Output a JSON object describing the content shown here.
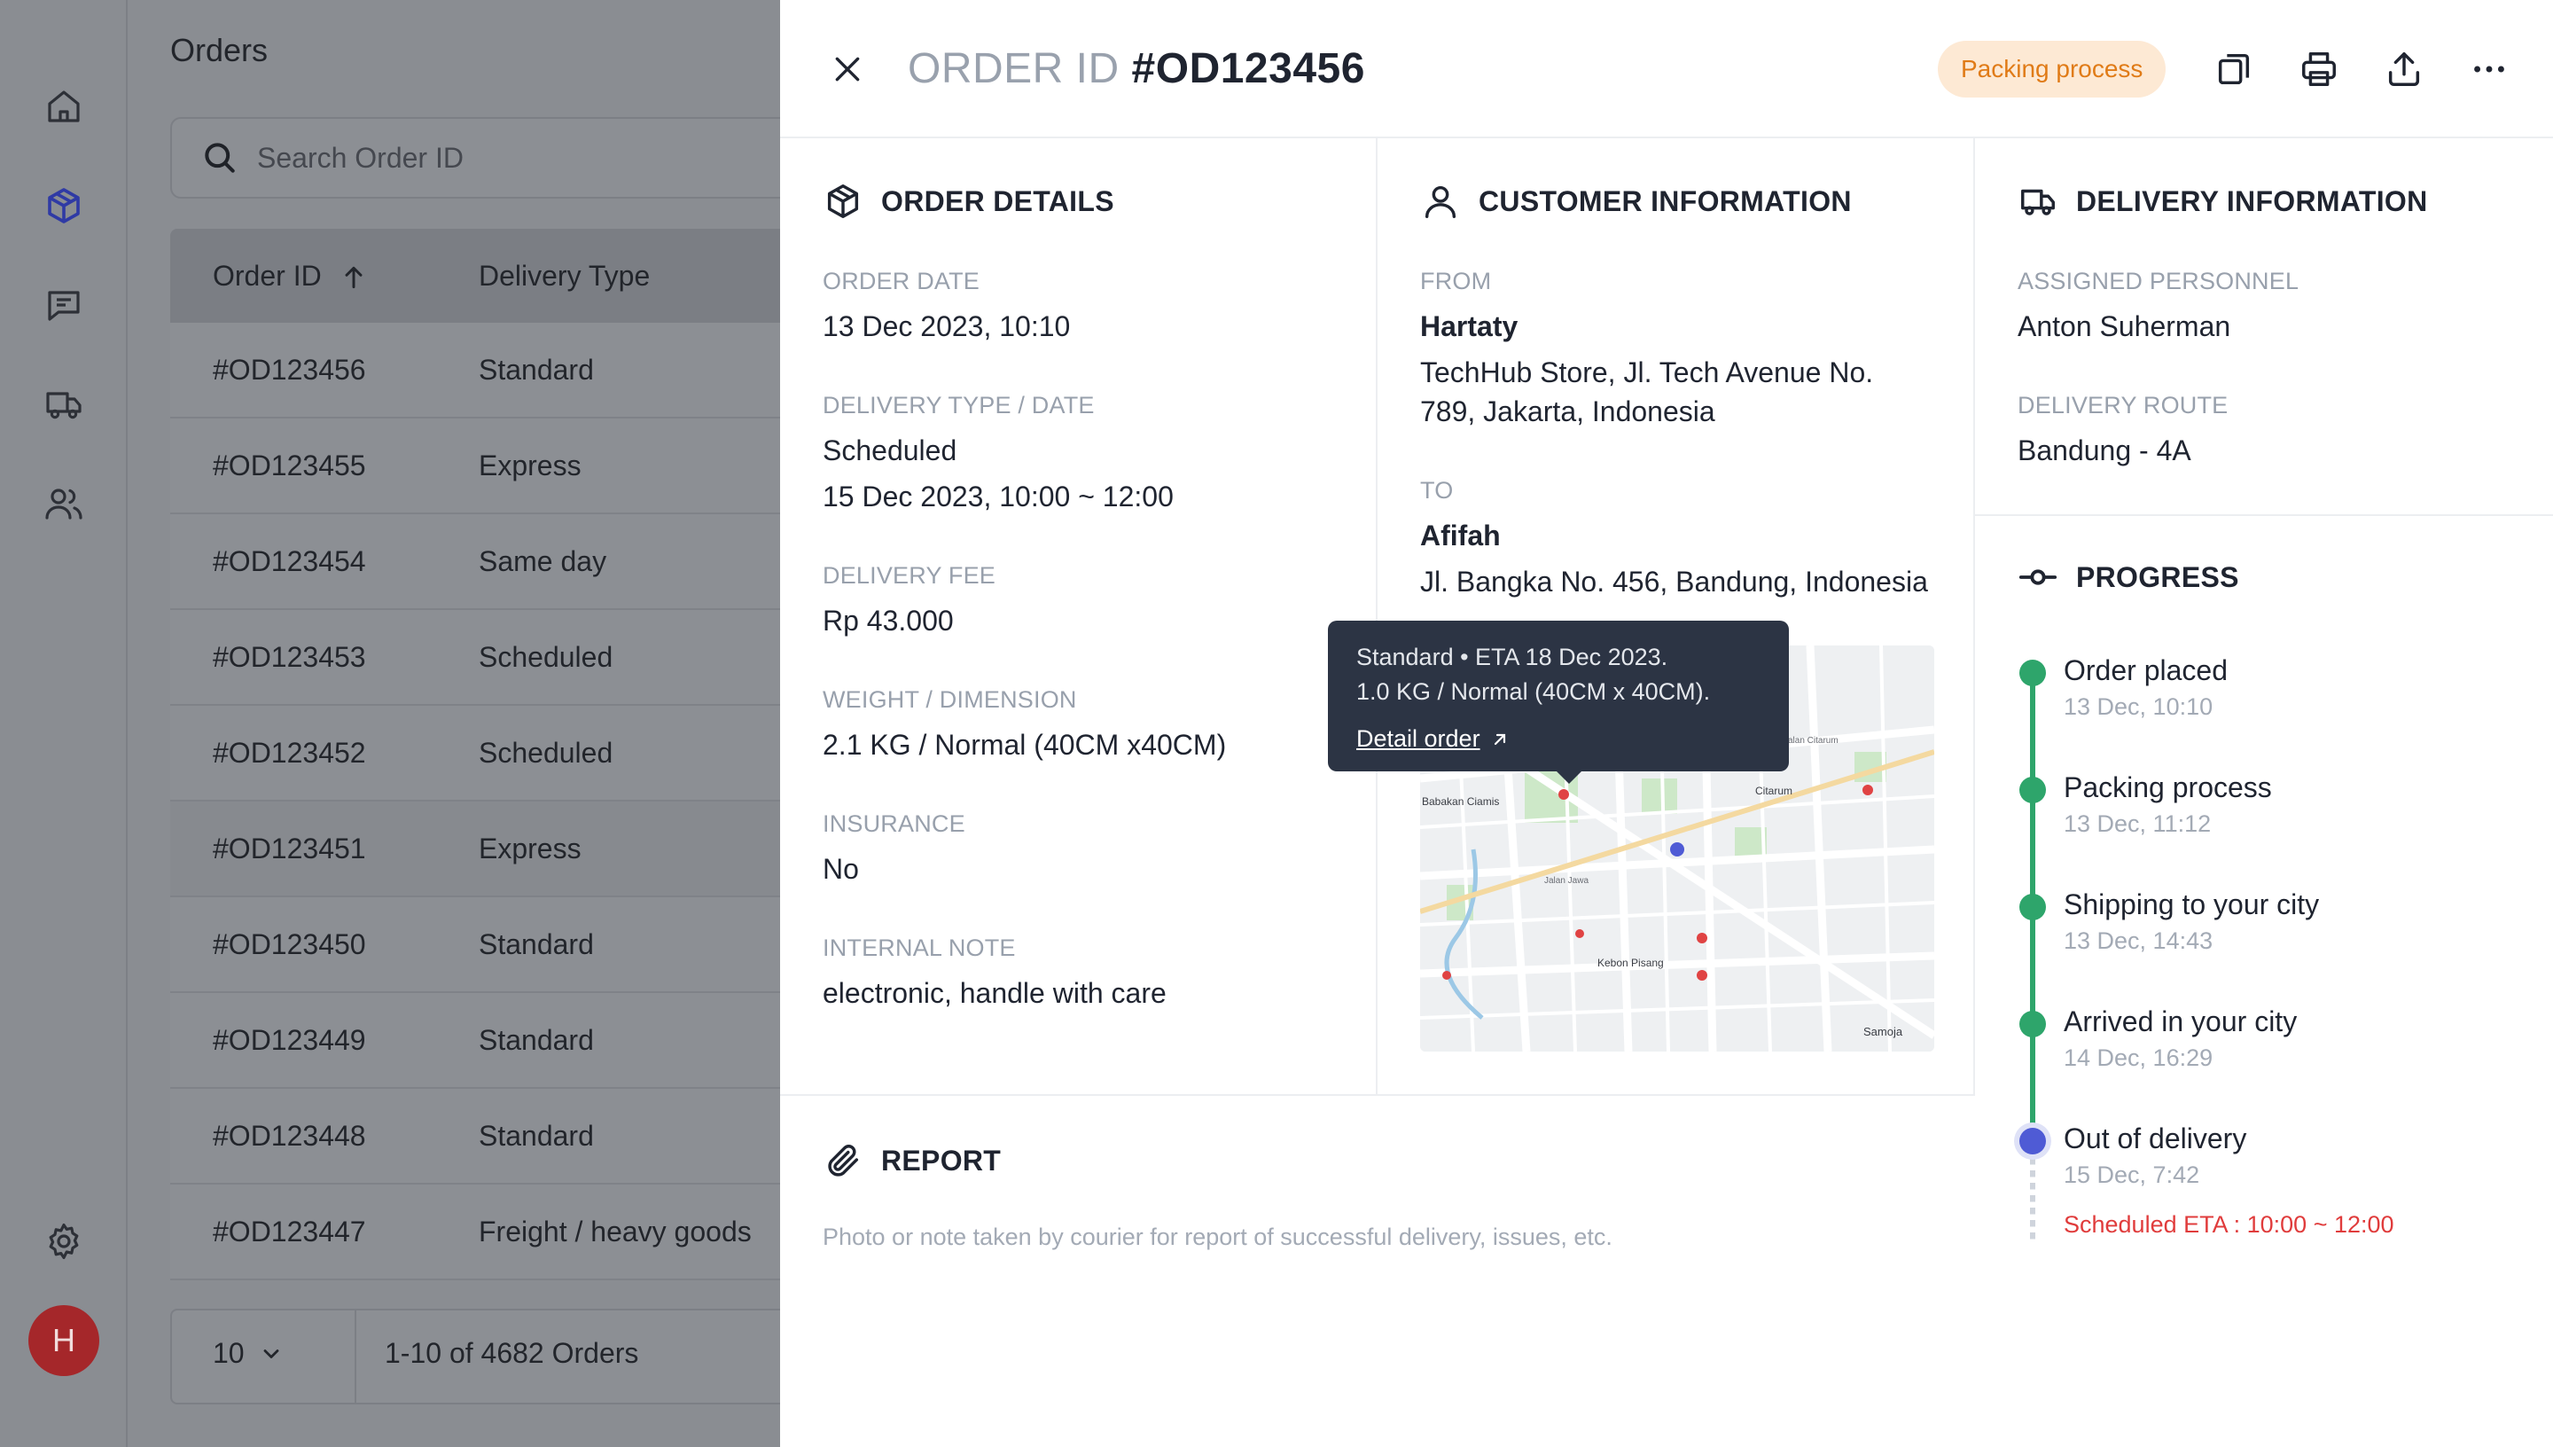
{
  "sidebar": {
    "avatar_initial": "H",
    "items": [
      {
        "name": "home",
        "icon": "home-icon"
      },
      {
        "name": "orders",
        "icon": "box-icon",
        "active": true
      },
      {
        "name": "messages",
        "icon": "chat-icon"
      },
      {
        "name": "delivery",
        "icon": "truck-icon"
      },
      {
        "name": "users",
        "icon": "users-icon"
      }
    ],
    "settings_icon": "gear-icon"
  },
  "orders_list": {
    "title": "Orders",
    "search_placeholder": "Search Order ID",
    "headers": {
      "order_id": "Order ID",
      "delivery_type": "Delivery Type"
    },
    "rows": [
      {
        "id": "#OD123456",
        "type": "Standard"
      },
      {
        "id": "#OD123455",
        "type": "Express"
      },
      {
        "id": "#OD123454",
        "type": "Same day"
      },
      {
        "id": "#OD123453",
        "type": "Scheduled"
      },
      {
        "id": "#OD123452",
        "type": "Scheduled"
      },
      {
        "id": "#OD123451",
        "type": "Express"
      },
      {
        "id": "#OD123450",
        "type": "Standard"
      },
      {
        "id": "#OD123449",
        "type": "Standard"
      },
      {
        "id": "#OD123448",
        "type": "Standard"
      },
      {
        "id": "#OD123447",
        "type": "Freight / heavy goods"
      }
    ],
    "pager": {
      "page_size": "10",
      "count_text": "1-10 of 4682 Orders"
    }
  },
  "drawer": {
    "title_label": "ORDER ID",
    "title_value": "#OD123456",
    "status": "Packing process",
    "status_color": "#e07b17",
    "order_details": {
      "title": "ORDER DETAILS",
      "order_date_label": "ORDER DATE",
      "order_date": "13 Dec 2023, 10:10",
      "delivery_type_label": "DELIVERY TYPE / DATE",
      "delivery_type": "Scheduled",
      "delivery_date": "15 Dec 2023, 10:00 ~ 12:00",
      "fee_label": "DELIVERY FEE",
      "fee": "Rp 43.000",
      "weight_label": "WEIGHT / DIMENSION",
      "weight": "2.1 KG / Normal (40CM x40CM)",
      "insurance_label": "INSURANCE",
      "insurance": "No",
      "note_label": "INTERNAL NOTE",
      "note": "electronic, handle with care"
    },
    "customer": {
      "title": "CUSTOMER INFORMATION",
      "from_label": "FROM",
      "from_name": "Hartaty",
      "from_addr_1": "TechHub Store, Jl. Tech Avenue No.",
      "from_addr_2": "789, Jakarta, Indonesia",
      "to_label": "TO",
      "to_name": "Afifah",
      "to_addr": "Jl. Bangka No. 456, Bandung, Indonesia"
    },
    "map_labels": {
      "a": "Babakan Ciamis",
      "b": "Citarum",
      "c": "Kebon Pisang",
      "d": "Samoja",
      "e": "Jalan Jawa",
      "f": "Jalan Citarum"
    },
    "tooltip": {
      "line1": "Standard • ETA 18 Dec 2023.",
      "line2": "1.0 KG / Normal (40CM x 40CM).",
      "link": "Detail order"
    },
    "report": {
      "title": "REPORT",
      "placeholder": "Photo or note taken by courier for report of successful delivery, issues, etc."
    },
    "delivery": {
      "title": "DELIVERY INFORMATION",
      "personnel_label": "ASSIGNED PERSONNEL",
      "personnel": "Anton Suherman",
      "route_label": "DELIVERY ROUTE",
      "route": "Bandung - 4A"
    },
    "progress": {
      "title": "PROGRESS",
      "steps": [
        {
          "title": "Order placed",
          "time": "13 Dec, 10:10"
        },
        {
          "title": "Packing process",
          "time": "13 Dec, 11:12"
        },
        {
          "title": "Shipping to your city",
          "time": "13 Dec, 14:43"
        },
        {
          "title": "Arrived in your city",
          "time": "14 Dec, 16:29"
        },
        {
          "title": "Out of delivery",
          "time": "15 Dec, 7:42"
        }
      ],
      "eta": "Scheduled ETA : 10:00 ~ 12:00",
      "done_color": "#2ea56b",
      "current_color": "#4f5bd5",
      "eta_color": "#e03c3c"
    }
  }
}
